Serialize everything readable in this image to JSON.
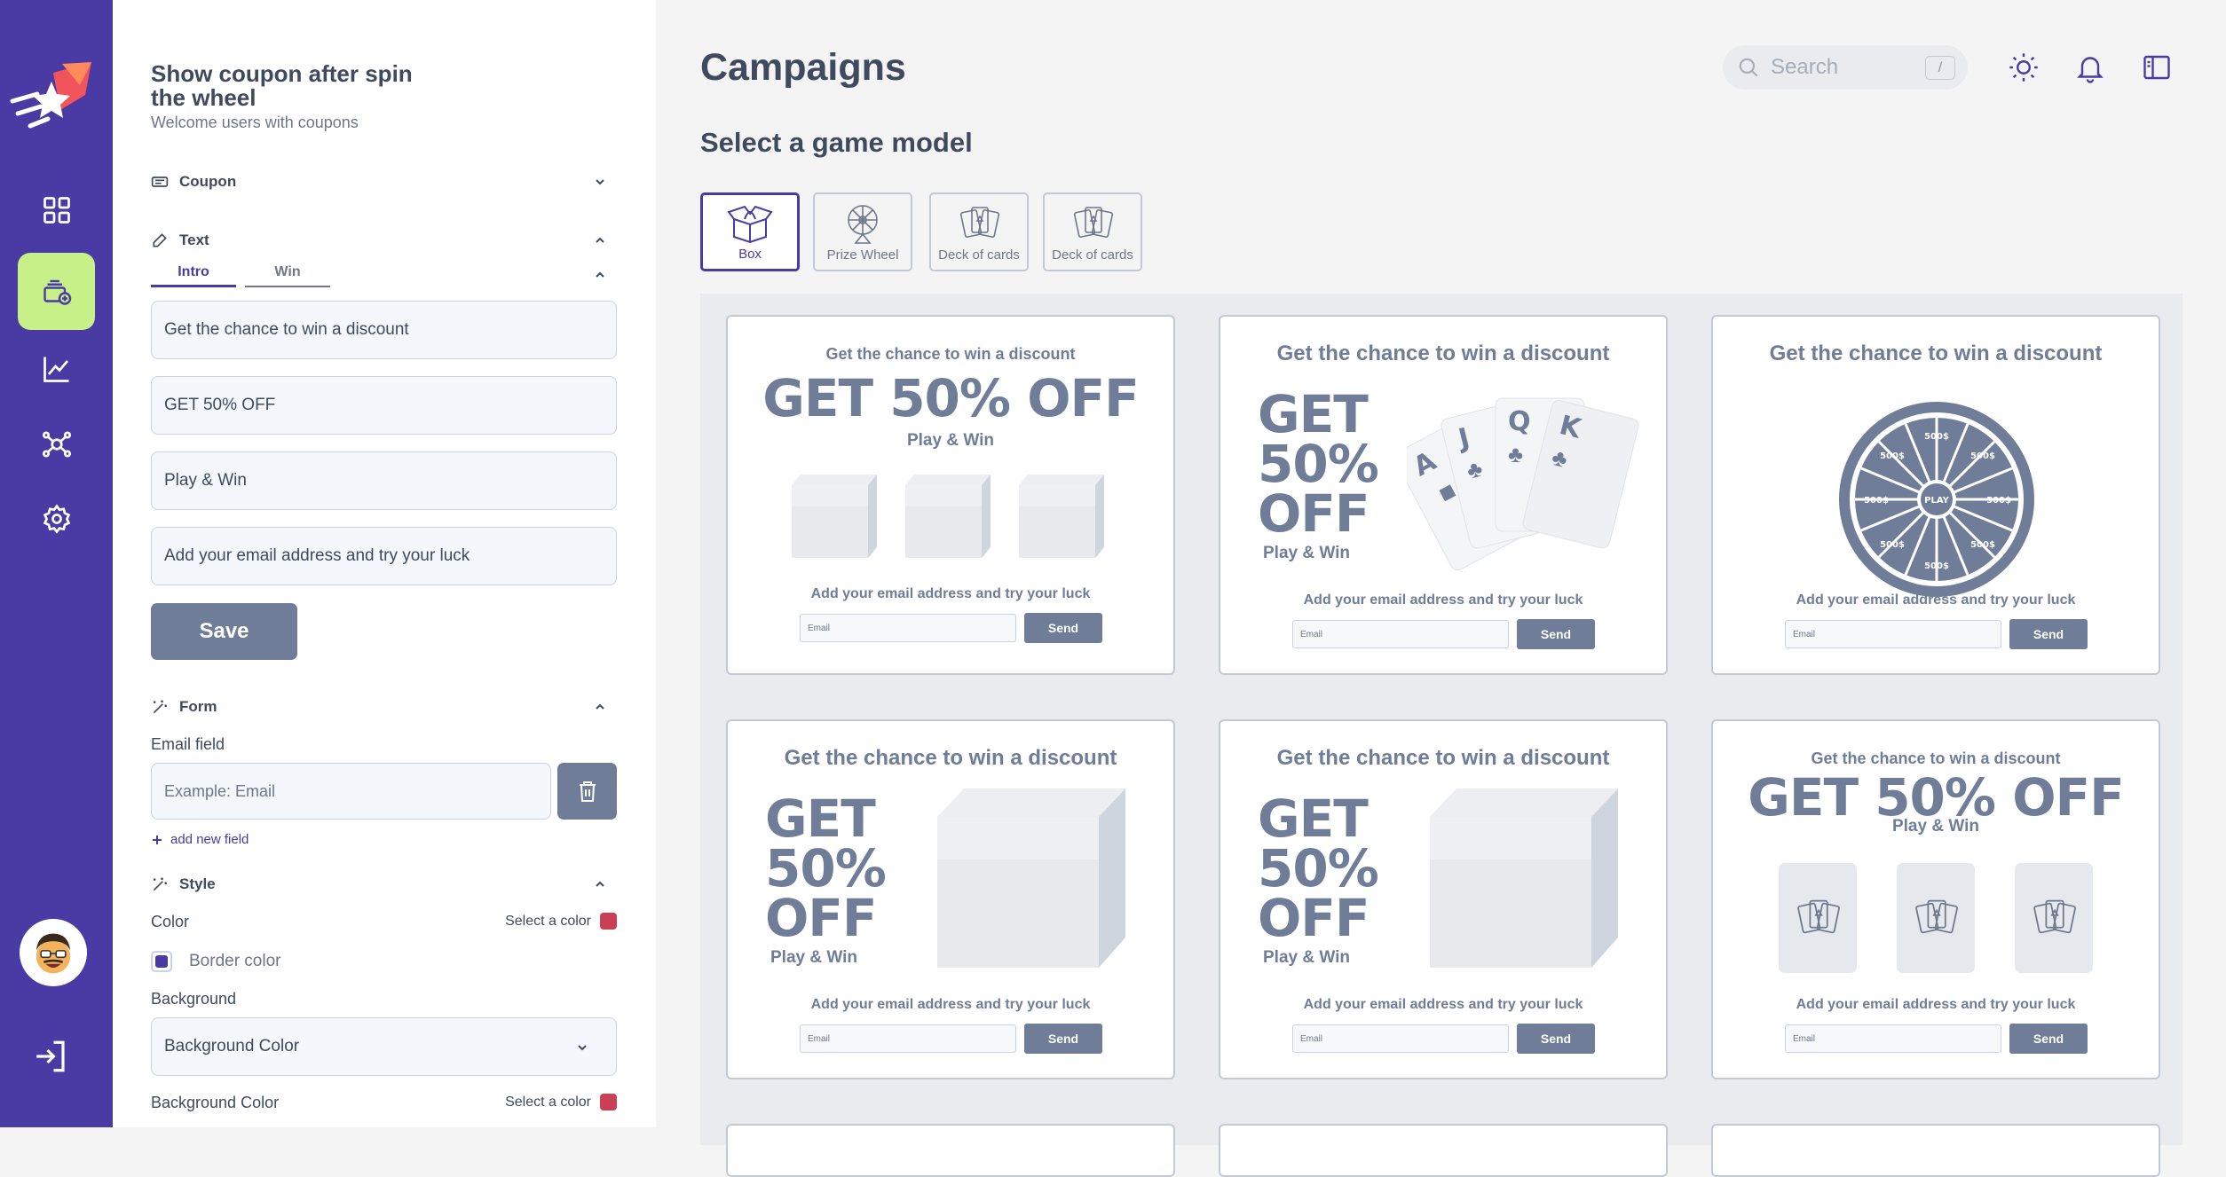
{
  "sidebar": {
    "items": [
      {
        "icon": "grid-icon",
        "active": false
      },
      {
        "icon": "campaign-add-icon",
        "active": true
      },
      {
        "icon": "analytics-chart-icon",
        "active": false
      },
      {
        "icon": "network-hub-icon",
        "active": false
      },
      {
        "icon": "gear-icon",
        "active": false
      }
    ],
    "accent_active": "#c7f089",
    "background": "#4a3aa4"
  },
  "panel": {
    "title": "Show coupon after spin the wheel",
    "subtitle": "Welcome users with coupons",
    "sections": {
      "coupon": "Coupon",
      "text": "Text",
      "form": "Form",
      "style": "Style"
    },
    "text_tabs": [
      "Intro",
      "Win"
    ],
    "text_fields": [
      "Get the chance to win a discount",
      "GET 50% OFF",
      "Play & Win",
      "Add your email address and try your luck"
    ],
    "save_label": "Save",
    "email_field_label": "Email field",
    "email_field_placeholder": "Example: Email",
    "add_field_label": "add new field",
    "color_label": "Color",
    "select_color_label": "Select a color",
    "border_color_label": "Border color",
    "background_label": "Background",
    "background_select_value": "Background Color",
    "background_color_label": "Background Color",
    "swatch_color": "#c94055"
  },
  "main": {
    "title": "Campaigns",
    "search_placeholder": "Search",
    "search_shortcut": "/",
    "section_title": "Select a game model",
    "game_models": [
      "Box",
      "Prize Wheel",
      "Deck of cards",
      "Deck of cards"
    ],
    "cards": {
      "heading": "Get the chance to win a discount",
      "offer": "GET 50% OFF",
      "offer_line1": "GET",
      "offer_line2": "50%",
      "offer_line3": "OFF",
      "tagline": "Play & Win",
      "cta": "Add your email address and try your luck",
      "email_placeholder": "Email",
      "send_label": "Send",
      "wheel_center": "PLAY",
      "wheel_segment": "500$",
      "card_letters": [
        "A",
        "J",
        "Q",
        "K"
      ]
    }
  }
}
